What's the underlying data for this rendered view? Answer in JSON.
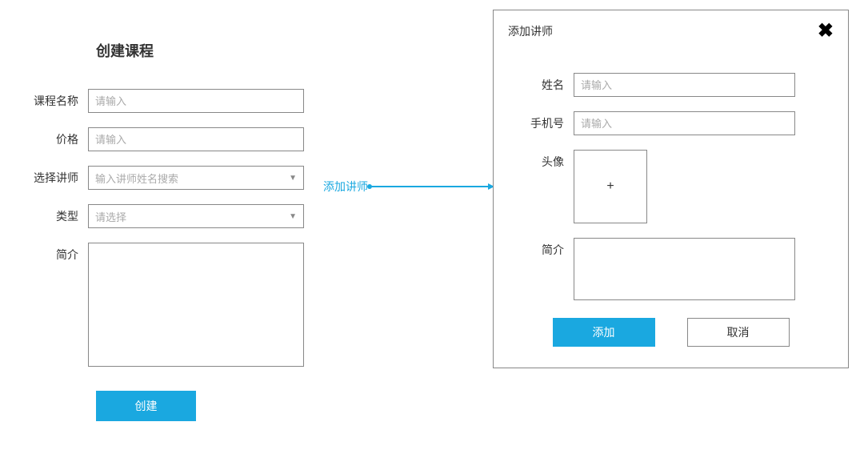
{
  "leftForm": {
    "title": "创建课程",
    "fields": {
      "courseName": {
        "label": "课程名称",
        "placeholder": "请输入"
      },
      "price": {
        "label": "价格",
        "placeholder": "请输入"
      },
      "teacher": {
        "label": "选择讲师",
        "placeholder": "输入讲师姓名搜索"
      },
      "type": {
        "label": "类型",
        "placeholder": "请选择"
      },
      "intro": {
        "label": "简介"
      }
    },
    "addTeacherLink": "添加讲师",
    "submitLabel": "创建"
  },
  "modal": {
    "title": "添加讲师",
    "fields": {
      "name": {
        "label": "姓名",
        "placeholder": "请输入"
      },
      "phone": {
        "label": "手机号",
        "placeholder": "请输入"
      },
      "avatar": {
        "label": "头像",
        "uploadSymbol": "+"
      },
      "intro": {
        "label": "简介"
      }
    },
    "addLabel": "添加",
    "cancelLabel": "取消"
  }
}
